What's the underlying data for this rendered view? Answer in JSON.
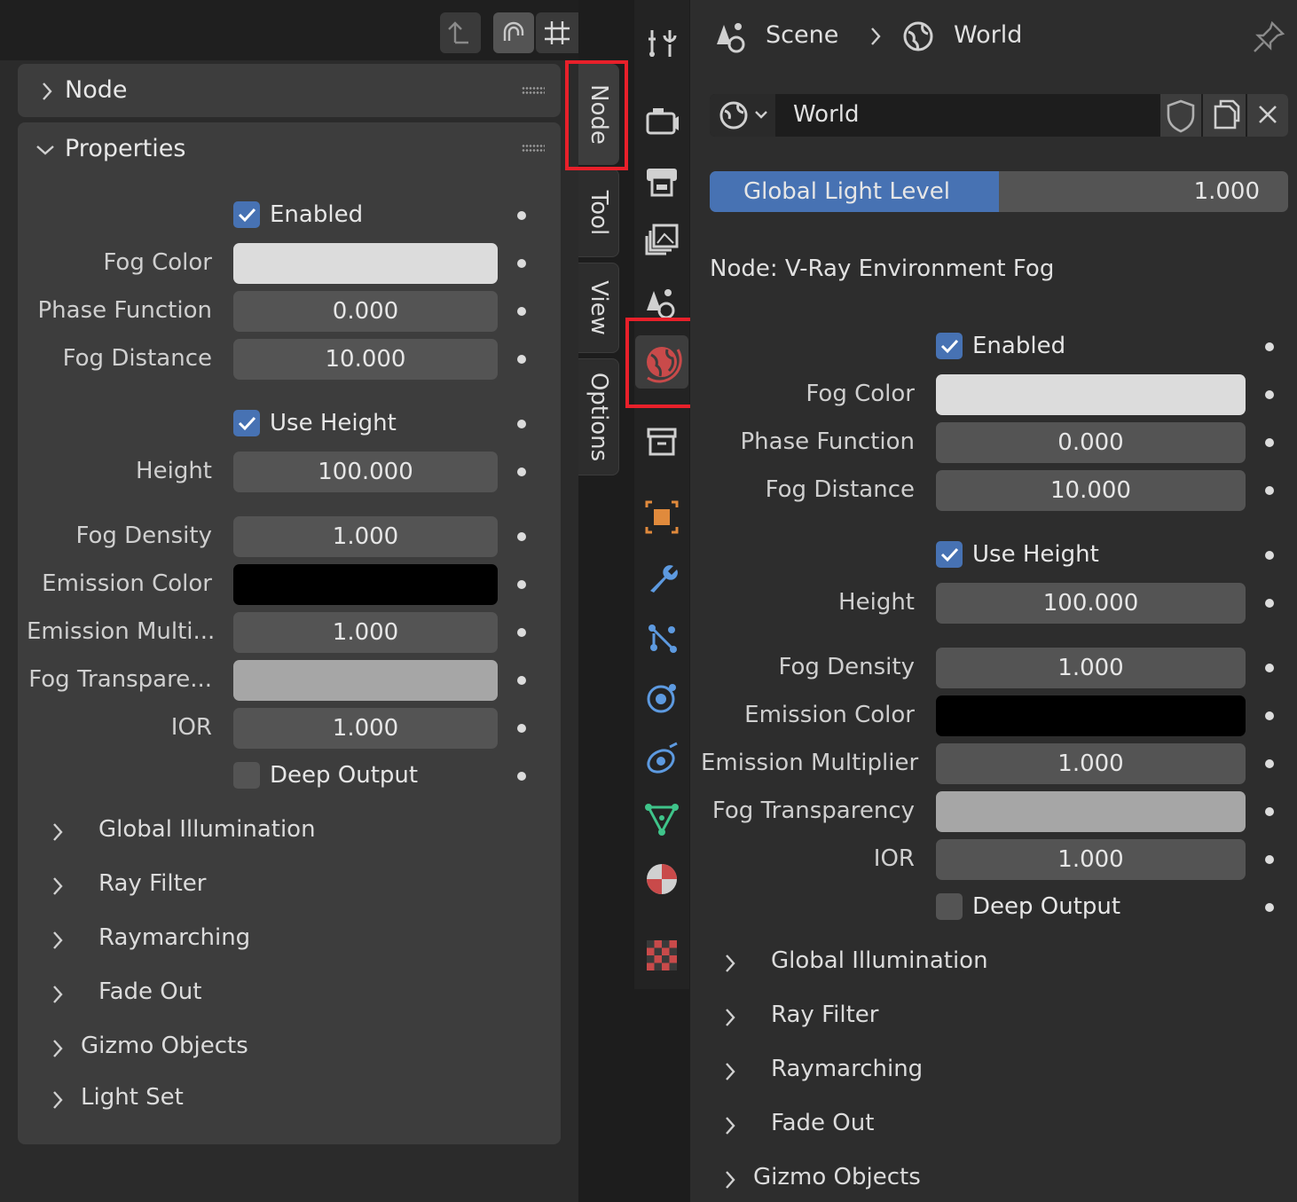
{
  "left_panel": {
    "node_section": {
      "title": "Node"
    },
    "properties_section": {
      "title": "Properties",
      "enabled": {
        "label": "Enabled",
        "checked": true
      },
      "fog_color": {
        "label": "Fog Color",
        "color": "#dcdcdc"
      },
      "phase_function": {
        "label": "Phase Function",
        "value": "0.000"
      },
      "fog_distance": {
        "label": "Fog Distance",
        "value": "10.000"
      },
      "use_height": {
        "label": "Use Height",
        "checked": true
      },
      "height": {
        "label": "Height",
        "value": "100.000"
      },
      "fog_density": {
        "label": "Fog Density",
        "value": "1.000"
      },
      "emission_color": {
        "label": "Emission Color",
        "color": "#000000"
      },
      "emission_multiplier": {
        "label": "Emission Multi...",
        "value": "1.000"
      },
      "fog_transparency": {
        "label": "Fog Transpare...",
        "color": "#a6a6a6"
      },
      "ior": {
        "label": "IOR",
        "value": "1.000"
      },
      "deep_output": {
        "label": "Deep Output",
        "checked": false
      },
      "subpanels": [
        "Global Illumination",
        "Ray Filter",
        "Raymarching",
        "Fade Out"
      ],
      "panels": [
        "Gizmo Objects",
        "Light Set"
      ]
    },
    "tabs": [
      "Node",
      "Tool",
      "View",
      "Options"
    ],
    "active_tab": "Node"
  },
  "properties_editor": {
    "breadcrumb": {
      "scene": "Scene",
      "world": "World"
    },
    "world_selector": {
      "name": "World"
    },
    "global_light_level": {
      "label": "Global Light Level",
      "value": "1.000",
      "fraction": 0.5
    },
    "node_label": "Node:  V-Ray Environment Fog",
    "enabled": {
      "label": "Enabled",
      "checked": true
    },
    "fog_color": {
      "label": "Fog Color",
      "color": "#dcdcdc"
    },
    "phase_function": {
      "label": "Phase Function",
      "value": "0.000"
    },
    "fog_distance": {
      "label": "Fog Distance",
      "value": "10.000"
    },
    "use_height": {
      "label": "Use Height",
      "checked": true
    },
    "height": {
      "label": "Height",
      "value": "100.000"
    },
    "fog_density": {
      "label": "Fog Density",
      "value": "1.000"
    },
    "emission_color": {
      "label": "Emission Color",
      "color": "#000000"
    },
    "emission_multiplier": {
      "label": "Emission Multiplier",
      "value": "1.000"
    },
    "fog_transparency": {
      "label": "Fog Transparency",
      "color": "#a6a6a6"
    },
    "ior": {
      "label": "IOR",
      "value": "1.000"
    },
    "deep_output": {
      "label": "Deep Output",
      "checked": false
    },
    "subpanels": [
      "Global Illumination",
      "Ray Filter",
      "Raymarching",
      "Fade Out"
    ],
    "panels": [
      "Gizmo Objects"
    ],
    "active_tab": "world-tab"
  },
  "colors": {
    "accent": "#4772b3",
    "highlight_box": "#e8202a"
  }
}
